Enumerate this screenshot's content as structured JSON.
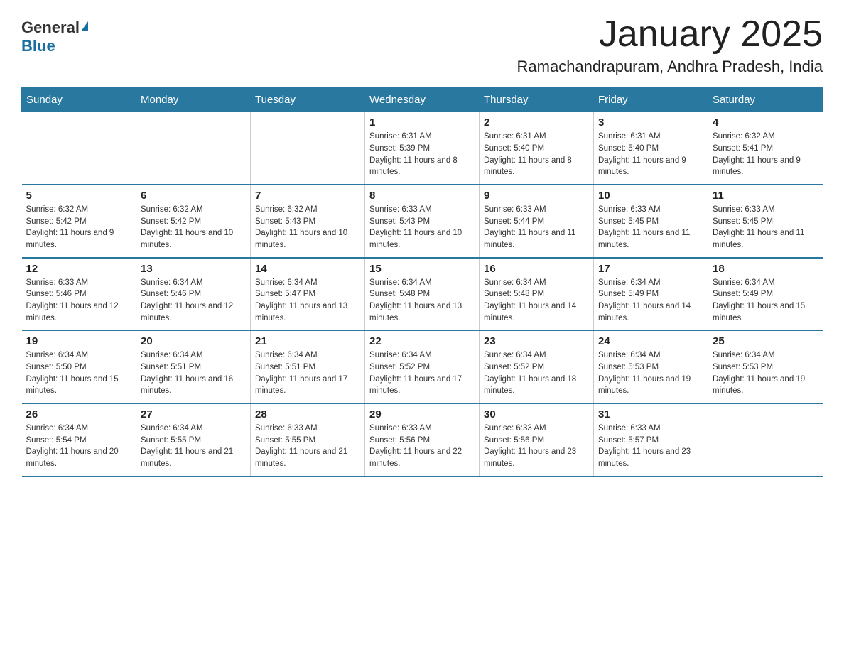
{
  "header": {
    "logo_general": "General",
    "logo_blue": "Blue",
    "month_title": "January 2025",
    "location": "Ramachandrapuram, Andhra Pradesh, India"
  },
  "days_of_week": [
    "Sunday",
    "Monday",
    "Tuesday",
    "Wednesday",
    "Thursday",
    "Friday",
    "Saturday"
  ],
  "weeks": [
    [
      {
        "day": "",
        "info": ""
      },
      {
        "day": "",
        "info": ""
      },
      {
        "day": "",
        "info": ""
      },
      {
        "day": "1",
        "info": "Sunrise: 6:31 AM\nSunset: 5:39 PM\nDaylight: 11 hours and 8 minutes."
      },
      {
        "day": "2",
        "info": "Sunrise: 6:31 AM\nSunset: 5:40 PM\nDaylight: 11 hours and 8 minutes."
      },
      {
        "day": "3",
        "info": "Sunrise: 6:31 AM\nSunset: 5:40 PM\nDaylight: 11 hours and 9 minutes."
      },
      {
        "day": "4",
        "info": "Sunrise: 6:32 AM\nSunset: 5:41 PM\nDaylight: 11 hours and 9 minutes."
      }
    ],
    [
      {
        "day": "5",
        "info": "Sunrise: 6:32 AM\nSunset: 5:42 PM\nDaylight: 11 hours and 9 minutes."
      },
      {
        "day": "6",
        "info": "Sunrise: 6:32 AM\nSunset: 5:42 PM\nDaylight: 11 hours and 10 minutes."
      },
      {
        "day": "7",
        "info": "Sunrise: 6:32 AM\nSunset: 5:43 PM\nDaylight: 11 hours and 10 minutes."
      },
      {
        "day": "8",
        "info": "Sunrise: 6:33 AM\nSunset: 5:43 PM\nDaylight: 11 hours and 10 minutes."
      },
      {
        "day": "9",
        "info": "Sunrise: 6:33 AM\nSunset: 5:44 PM\nDaylight: 11 hours and 11 minutes."
      },
      {
        "day": "10",
        "info": "Sunrise: 6:33 AM\nSunset: 5:45 PM\nDaylight: 11 hours and 11 minutes."
      },
      {
        "day": "11",
        "info": "Sunrise: 6:33 AM\nSunset: 5:45 PM\nDaylight: 11 hours and 11 minutes."
      }
    ],
    [
      {
        "day": "12",
        "info": "Sunrise: 6:33 AM\nSunset: 5:46 PM\nDaylight: 11 hours and 12 minutes."
      },
      {
        "day": "13",
        "info": "Sunrise: 6:34 AM\nSunset: 5:46 PM\nDaylight: 11 hours and 12 minutes."
      },
      {
        "day": "14",
        "info": "Sunrise: 6:34 AM\nSunset: 5:47 PM\nDaylight: 11 hours and 13 minutes."
      },
      {
        "day": "15",
        "info": "Sunrise: 6:34 AM\nSunset: 5:48 PM\nDaylight: 11 hours and 13 minutes."
      },
      {
        "day": "16",
        "info": "Sunrise: 6:34 AM\nSunset: 5:48 PM\nDaylight: 11 hours and 14 minutes."
      },
      {
        "day": "17",
        "info": "Sunrise: 6:34 AM\nSunset: 5:49 PM\nDaylight: 11 hours and 14 minutes."
      },
      {
        "day": "18",
        "info": "Sunrise: 6:34 AM\nSunset: 5:49 PM\nDaylight: 11 hours and 15 minutes."
      }
    ],
    [
      {
        "day": "19",
        "info": "Sunrise: 6:34 AM\nSunset: 5:50 PM\nDaylight: 11 hours and 15 minutes."
      },
      {
        "day": "20",
        "info": "Sunrise: 6:34 AM\nSunset: 5:51 PM\nDaylight: 11 hours and 16 minutes."
      },
      {
        "day": "21",
        "info": "Sunrise: 6:34 AM\nSunset: 5:51 PM\nDaylight: 11 hours and 17 minutes."
      },
      {
        "day": "22",
        "info": "Sunrise: 6:34 AM\nSunset: 5:52 PM\nDaylight: 11 hours and 17 minutes."
      },
      {
        "day": "23",
        "info": "Sunrise: 6:34 AM\nSunset: 5:52 PM\nDaylight: 11 hours and 18 minutes."
      },
      {
        "day": "24",
        "info": "Sunrise: 6:34 AM\nSunset: 5:53 PM\nDaylight: 11 hours and 19 minutes."
      },
      {
        "day": "25",
        "info": "Sunrise: 6:34 AM\nSunset: 5:53 PM\nDaylight: 11 hours and 19 minutes."
      }
    ],
    [
      {
        "day": "26",
        "info": "Sunrise: 6:34 AM\nSunset: 5:54 PM\nDaylight: 11 hours and 20 minutes."
      },
      {
        "day": "27",
        "info": "Sunrise: 6:34 AM\nSunset: 5:55 PM\nDaylight: 11 hours and 21 minutes."
      },
      {
        "day": "28",
        "info": "Sunrise: 6:33 AM\nSunset: 5:55 PM\nDaylight: 11 hours and 21 minutes."
      },
      {
        "day": "29",
        "info": "Sunrise: 6:33 AM\nSunset: 5:56 PM\nDaylight: 11 hours and 22 minutes."
      },
      {
        "day": "30",
        "info": "Sunrise: 6:33 AM\nSunset: 5:56 PM\nDaylight: 11 hours and 23 minutes."
      },
      {
        "day": "31",
        "info": "Sunrise: 6:33 AM\nSunset: 5:57 PM\nDaylight: 11 hours and 23 minutes."
      },
      {
        "day": "",
        "info": ""
      }
    ]
  ]
}
